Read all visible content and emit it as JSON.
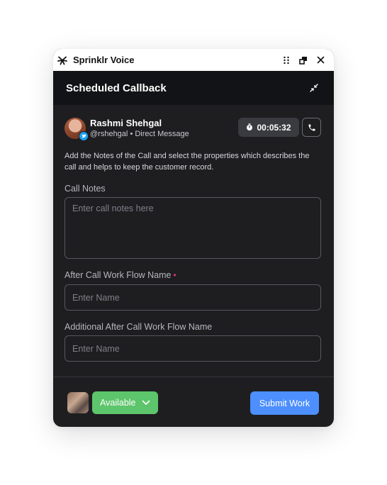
{
  "app": {
    "title": "Sprinklr Voice",
    "brand_color": "#111111"
  },
  "header": {
    "title": "Scheduled Callback"
  },
  "contact": {
    "name": "Rashmi Shehgal",
    "handle": "@rshehgal",
    "separator": "•",
    "channel": "Direct Message",
    "platform_icon": "twitter-icon"
  },
  "timer": {
    "value": "00:05:32",
    "icon": "stopwatch-icon"
  },
  "description": "Add the Notes of the Call and select the properties which describes the call and helps to keep the customer record.",
  "form": {
    "call_notes": {
      "label": "Call Notes",
      "placeholder": "Enter call notes here",
      "value": ""
    },
    "acw_flow": {
      "label": "After Call Work Flow Name",
      "required_marker": "•",
      "placeholder": "Enter Name",
      "value": ""
    },
    "additional_acw_flow": {
      "label": "Additional After Call Work Flow Name",
      "placeholder": "Enter Name",
      "value": ""
    }
  },
  "footer": {
    "status": {
      "label": "Available",
      "color": "#5dc56b"
    },
    "submit_label": "Submit Work",
    "submit_color": "#4d8fff"
  },
  "colors": {
    "panel_bg": "#1e1e21",
    "header_bg": "#121316",
    "required": "#e0356d"
  }
}
